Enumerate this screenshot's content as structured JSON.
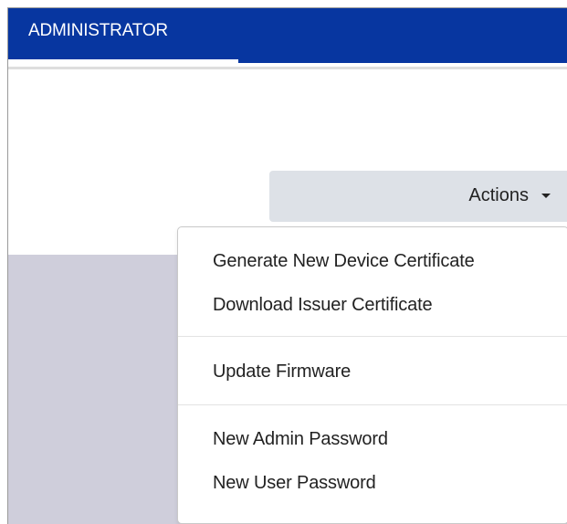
{
  "header": {
    "tab_label": "ADMINISTRATOR"
  },
  "actions": {
    "label": "Actions",
    "caret_icon": "caret-down-icon"
  },
  "menu": {
    "items": [
      {
        "label": "Generate New Device Certificate"
      },
      {
        "label": "Download Issuer Certificate"
      },
      {
        "label": "Update Firmware"
      },
      {
        "label": "New Admin Password"
      },
      {
        "label": "New User Password"
      }
    ]
  },
  "colors": {
    "header_background": "#0736a0",
    "panel_background": "#cfcedb",
    "button_background": "#dde1e7"
  }
}
